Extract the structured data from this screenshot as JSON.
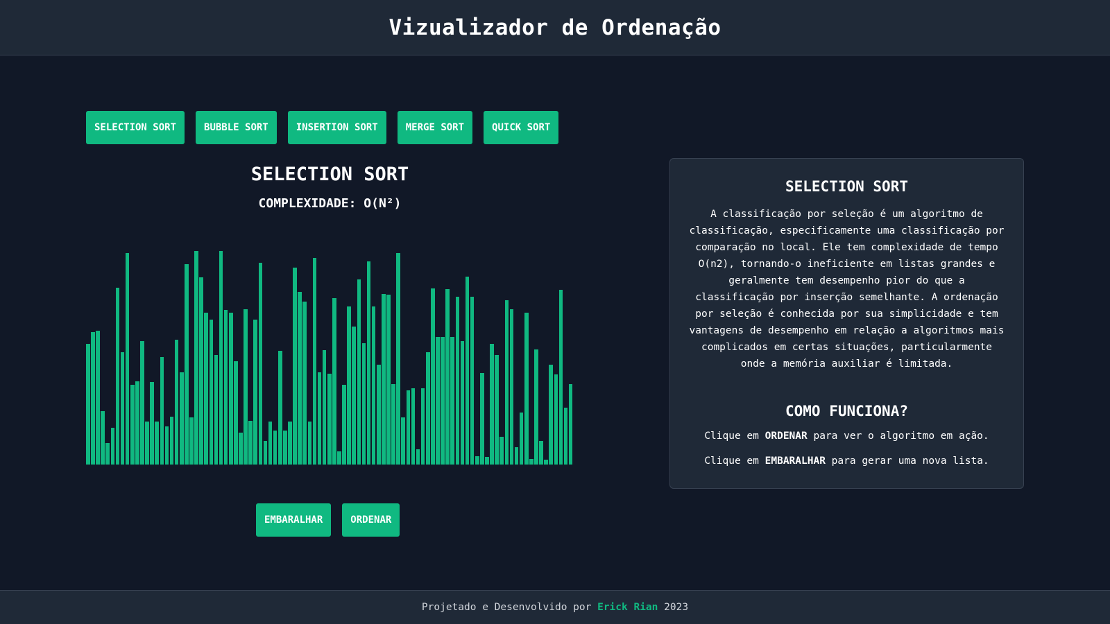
{
  "header": {
    "title": "Vizualizador de Ordenação"
  },
  "algorithms": [
    "SELECTION SORT",
    "BUBBLE SORT",
    "INSERTION SORT",
    "MERGE SORT",
    "QUICK SORT"
  ],
  "visualizer": {
    "title": "SELECTION SORT",
    "complexity": "COMPLEXIDADE: O(N²)"
  },
  "controls": {
    "shuffle": "EMBARALHAR",
    "sort": "ORDENAR"
  },
  "info": {
    "title": "SELECTION SORT",
    "description": "A classificação por seleção é um algoritmo de classificação, especificamente uma classificação por comparação no local. Ele tem complexidade de tempo O(n2), tornando-o ineficiente em listas grandes e geralmente tem desempenho pior do que a classificação por inserção semelhante. A ordenação por seleção é conhecida por sua simplicidade e tem vantagens de desempenho em relação a algoritmos mais complicados em certas situações, particularmente onde a memória auxiliar é limitada.",
    "how_title": "COMO FUNCIONA?",
    "how_1_prefix": "Clique em ",
    "how_1_bold": "ORDENAR",
    "how_1_suffix": " para ver o algoritmo em ação.",
    "how_2_prefix": "Clique em ",
    "how_2_bold": "EMBARALHAR",
    "how_2_suffix": " para gerar uma nova lista."
  },
  "footer": {
    "prefix": "Projetado e Desenvolvido por ",
    "author": "Erick Rian",
    "year": " 2023"
  },
  "colors": {
    "accent": "#10b981",
    "background": "#111827",
    "panel": "#1f2937"
  },
  "chart_data": {
    "type": "bar",
    "title": "",
    "max": 300,
    "values": [
      168,
      185,
      187,
      75,
      30,
      51,
      247,
      157,
      295,
      111,
      116,
      172,
      60,
      115,
      60,
      150,
      53,
      67,
      174,
      129,
      280,
      66,
      298,
      261,
      212,
      202,
      153,
      298,
      216,
      212,
      144,
      45,
      217,
      61,
      202,
      282,
      33,
      60,
      47,
      159,
      47,
      60,
      275,
      241,
      227,
      60,
      288,
      129,
      160,
      127,
      232,
      18,
      111,
      221,
      193,
      258,
      169,
      284,
      221,
      139,
      238,
      237,
      112,
      295,
      66,
      104,
      106,
      21,
      106,
      157,
      246,
      178,
      178,
      245,
      178,
      234,
      172,
      262,
      234,
      12,
      128,
      11,
      168,
      153,
      39,
      229,
      217,
      24,
      73,
      212,
      8,
      161,
      33,
      7,
      139,
      126,
      244,
      79,
      112
    ]
  }
}
